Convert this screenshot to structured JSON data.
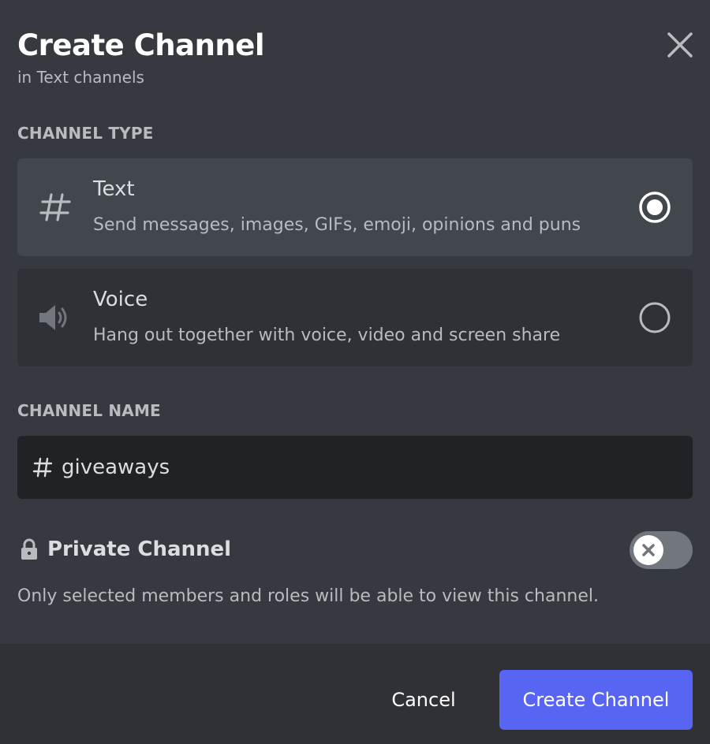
{
  "dialog": {
    "title": "Create Channel",
    "subtitle": "in Text channels",
    "close_icon": "close-icon"
  },
  "channel_type": {
    "label": "CHANNEL TYPE",
    "options": [
      {
        "name": "Text",
        "description": "Send messages, images, GIFs, emoji, opinions and puns",
        "icon": "hash-icon",
        "selected": true
      },
      {
        "name": "Voice",
        "description": "Hang out together with voice, video and screen share",
        "icon": "speaker-icon",
        "selected": false
      }
    ]
  },
  "channel_name": {
    "label": "CHANNEL NAME",
    "prefix_icon": "hash-icon",
    "value": "giveaways"
  },
  "private_channel": {
    "label": "Private Channel",
    "icon": "lock-icon",
    "enabled": false,
    "description": "Only selected members and roles will be able to view this channel."
  },
  "footer": {
    "cancel_label": "Cancel",
    "create_label": "Create Channel"
  },
  "colors": {
    "background": "#36393f",
    "footer": "#2f3136",
    "option_selected": "#42464d",
    "option": "#2f3136",
    "input": "#202225",
    "accent": "#5865f2",
    "toggle_off": "#72767d"
  }
}
